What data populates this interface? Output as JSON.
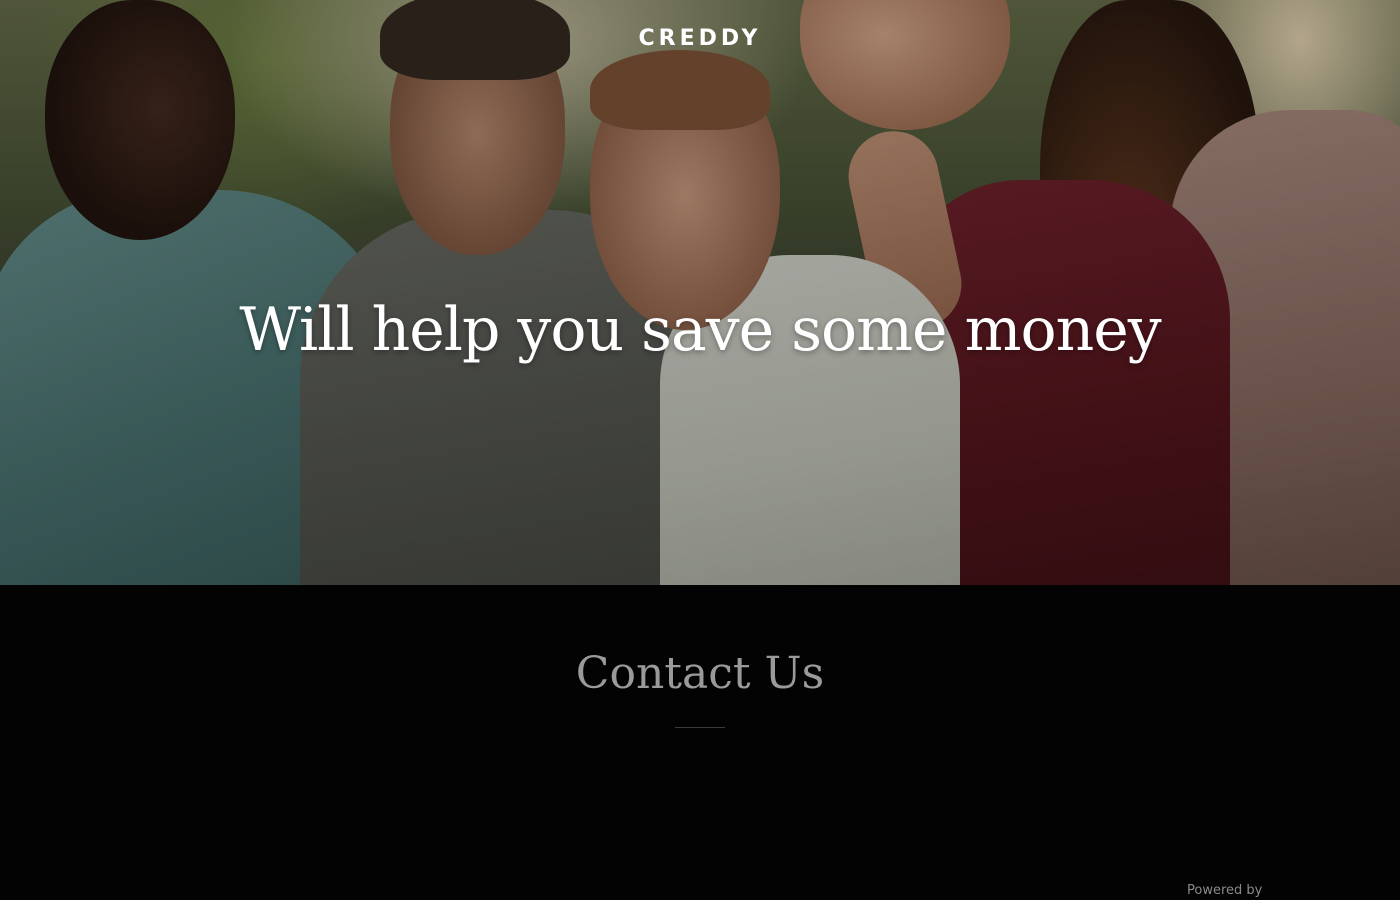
{
  "header": {
    "logo_text": "CREDDY"
  },
  "hero": {
    "headline": "Will help you save some money",
    "image_subject": "group-of-friends-photo"
  },
  "contact": {
    "title": "Contact Us"
  },
  "footer": {
    "powered_by": "Powered by"
  },
  "colors": {
    "background": "#040404",
    "headline_text": "#ffffff",
    "contact_title": "#9a9a9a"
  }
}
